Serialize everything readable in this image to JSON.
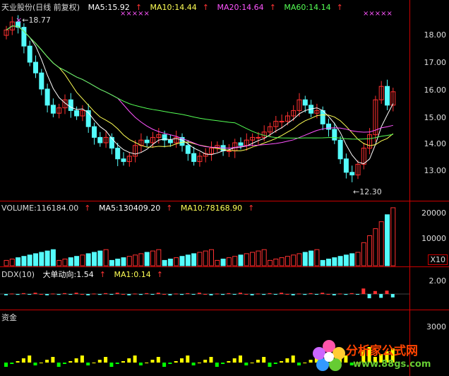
{
  "price_header": {
    "title": "天业股份(日线 前复权)",
    "ma5": "MA5:15.92",
    "ma10": "MA10:14.44",
    "ma20": "MA20:14.64",
    "ma60": "MA60:14.14",
    "arrow": "↑"
  },
  "price_annotations": {
    "high": "18.77",
    "low": "12.30",
    "high_marker": "×",
    "x_markers": "×××××"
  },
  "price_axis": [
    "18.00",
    "17.00",
    "16.00",
    "15.00",
    "14.00",
    "13.00"
  ],
  "volume_header": {
    "vol": "VOLUME:116184.00",
    "ma5": "MA5:130409.20",
    "ma10": "MA10:78168.90",
    "arrow": "↑"
  },
  "volume_axis": [
    "20000",
    "10000"
  ],
  "volume_unit": "X10",
  "ddx_header": {
    "label": "DDX(10)",
    "trend": "大单动向:1.54",
    "ma1": "MA1:0.14",
    "arrow": "↑"
  },
  "ddx_axis": [
    "2.00"
  ],
  "fund_header": {
    "label": "资金"
  },
  "fund_axis": [
    "3000"
  ],
  "watermark": {
    "name": "分析家公式网",
    "url": "www.88gs.com"
  },
  "colors": {
    "up": "#ff3030",
    "down": "#54fcfc",
    "ma5": "#ffffff",
    "ma10": "#ffff54",
    "ma20": "#ff54ff",
    "ma60": "#54ff54",
    "grid": "#cc0000",
    "fund_up": "#ffff00",
    "fund_down": "#00ff00"
  }
}
